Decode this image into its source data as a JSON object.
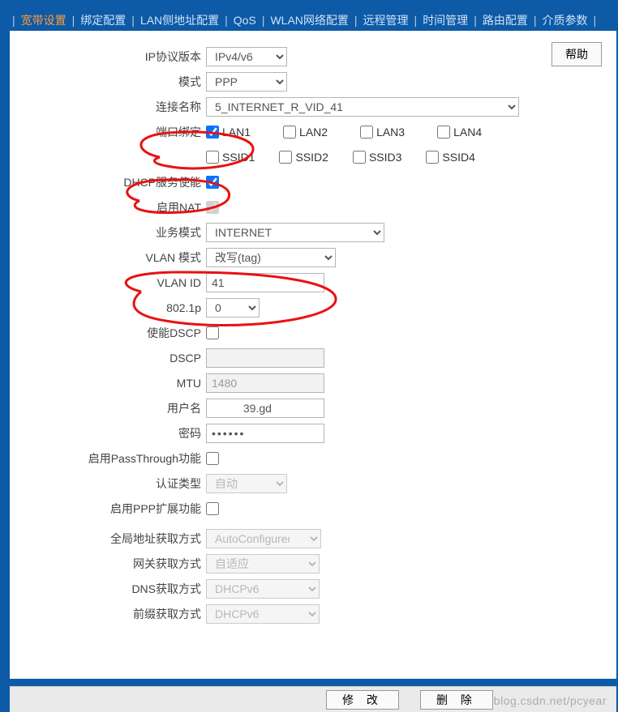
{
  "topbar": {
    "tabs": [
      {
        "label": "宽带设置",
        "active": true
      },
      {
        "label": "绑定配置"
      },
      {
        "label": "LAN侧地址配置"
      },
      {
        "label": "QoS"
      },
      {
        "label": "WLAN网络配置"
      },
      {
        "label": "远程管理"
      },
      {
        "label": "时间管理"
      },
      {
        "label": "路由配置"
      },
      {
        "label": "介质参数"
      }
    ]
  },
  "help_label": "帮助",
  "form": {
    "ip_ver": {
      "label": "IP协议版本",
      "value": "IPv4/v6"
    },
    "mode": {
      "label": "模式",
      "value": "PPP"
    },
    "conn": {
      "label": "连接名称",
      "value": "5_INTERNET_R_VID_41"
    },
    "portbind": {
      "label": "端口绑定",
      "lan": [
        "LAN1",
        "LAN2",
        "LAN3",
        "LAN4"
      ],
      "ssid": [
        "SSID1",
        "SSID2",
        "SSID3",
        "SSID4"
      ],
      "lan_checked": [
        true,
        false,
        false,
        false
      ],
      "ssid_checked": [
        false,
        false,
        false,
        false
      ]
    },
    "dhcp": {
      "label": "DHCP服务使能",
      "checked": true
    },
    "nat": {
      "label": "启用NAT",
      "checked": true,
      "disabled": true
    },
    "service": {
      "label": "业务模式",
      "value": "INTERNET"
    },
    "vlanmode": {
      "label": "VLAN 模式",
      "value": "改写(tag)"
    },
    "vlanid": {
      "label": "VLAN ID",
      "value": "41"
    },
    "p8021": {
      "label": "802.1p",
      "value": "0"
    },
    "dscp_en": {
      "label": "使能DSCP",
      "checked": false
    },
    "dscp": {
      "label": "DSCP",
      "value": ""
    },
    "mtu": {
      "label": "MTU",
      "value": "1480"
    },
    "user": {
      "label": "用户名",
      "value": "          39.gd"
    },
    "pwd": {
      "label": "密码",
      "value": "••••••"
    },
    "passthru": {
      "label": "启用PassThrough功能",
      "checked": false
    },
    "auth": {
      "label": "认证类型",
      "value": "自动"
    },
    "pppext": {
      "label": "启用PPP扩展功能",
      "checked": false
    },
    "globaladdr": {
      "label": "全局地址获取方式",
      "value": "AutoConfigured("
    },
    "gw": {
      "label": "网关获取方式",
      "value": "自适应"
    },
    "dns": {
      "label": "DNS获取方式",
      "value": "DHCPv6"
    },
    "prefix": {
      "label": "前缀获取方式",
      "value": "DHCPv6"
    }
  },
  "buttons": {
    "modify": "修 改",
    "delete": "删 除"
  },
  "watermark": "blog.csdn.net/pcyear"
}
